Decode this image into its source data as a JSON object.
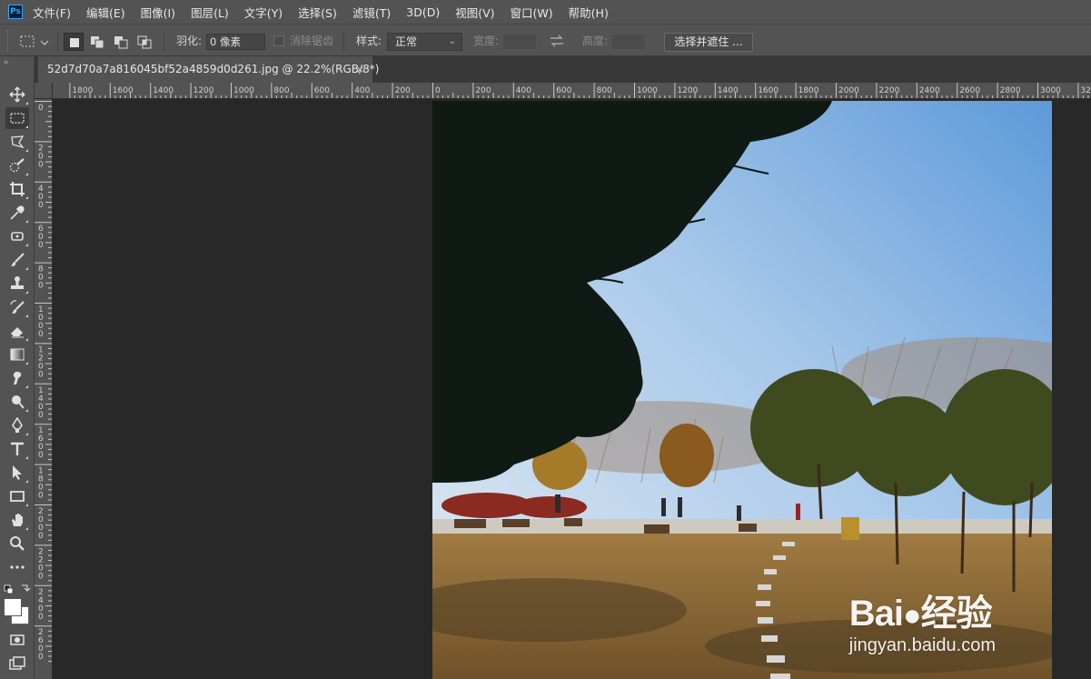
{
  "app": {
    "logo_text": "Ps"
  },
  "menu": [
    "文件(F)",
    "编辑(E)",
    "图像(I)",
    "图层(L)",
    "文字(Y)",
    "选择(S)",
    "滤镜(T)",
    "3D(D)",
    "视图(V)",
    "窗口(W)",
    "帮助(H)"
  ],
  "options": {
    "feather_label": "羽化:",
    "feather_value": "0 像素",
    "antialias_label": "消除锯齿",
    "style_label": "样式:",
    "style_value": "正常",
    "width_label": "宽度:",
    "height_label": "高度:",
    "select_mask_button": "选择并遮住 ..."
  },
  "document": {
    "tab_title": "52d7d70a7a816045bf52a4859d0d261.jpg @ 22.2%(RGB/8*)",
    "close_glyph": "×"
  },
  "rulers": {
    "horizontal_left": [
      "1800",
      "1600",
      "1400",
      "1200",
      "1000",
      "800",
      "600",
      "400",
      "200"
    ],
    "horizontal_right": [
      "0",
      "200",
      "400",
      "600",
      "800",
      "1000",
      "1200",
      "1400",
      "1600",
      "1800",
      "2000",
      "2200",
      "2400",
      "2600",
      "2800",
      "3000",
      "32"
    ],
    "vertical": [
      "0",
      "200",
      "400",
      "600",
      "800",
      "1000",
      "1200",
      "1400",
      "1600",
      "1800",
      "2000",
      "2200",
      "2400",
      "2600"
    ]
  },
  "tools": [
    "move-tool",
    "rectangular-marquee-tool",
    "lasso-tool",
    "quick-selection-tool",
    "crop-tool",
    "eyedropper-tool",
    "spot-healing-brush-tool",
    "brush-tool",
    "clone-stamp-tool",
    "history-brush-tool",
    "eraser-tool",
    "gradient-tool",
    "smudge-tool",
    "dodge-tool",
    "pen-tool",
    "type-tool",
    "path-selection-tool",
    "rectangle-tool",
    "hand-tool",
    "zoom-tool",
    "more-tools"
  ],
  "colors": {
    "foreground": "#ffffff",
    "background": "#ffffff",
    "ui_panel": "#535353",
    "canvas_bg": "#282828"
  },
  "watermark": {
    "brand": "Bai",
    "brand_cn": "经验",
    "url": "jingyan.baidu.com"
  }
}
